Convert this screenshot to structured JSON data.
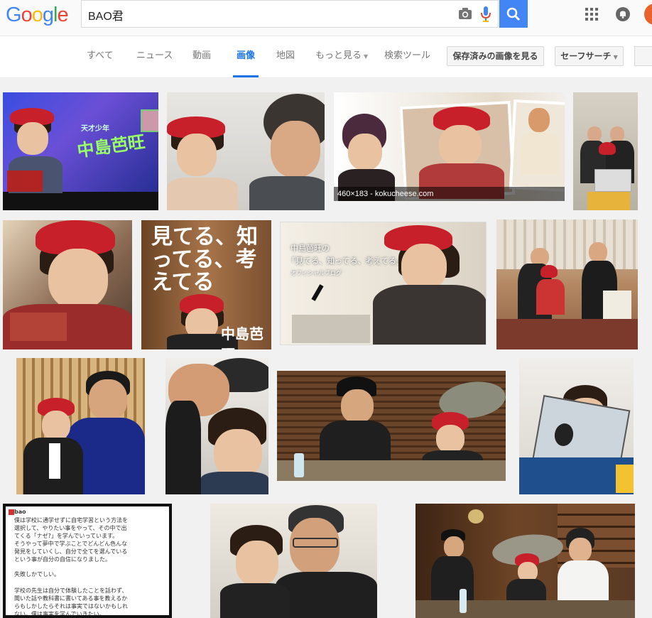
{
  "logo": "Google",
  "search": {
    "query": "BAO君"
  },
  "tabs": [
    {
      "label": "すべて"
    },
    {
      "label": "ニュース"
    },
    {
      "label": "動画"
    },
    {
      "label": "画像"
    },
    {
      "label": "地図"
    },
    {
      "label": "もっと見る"
    },
    {
      "label": "検索ツール"
    }
  ],
  "buttons": {
    "saved_images": "保存済みの画像を見る",
    "safe_search": "セーフサーチ"
  },
  "results": {
    "r1_caption": "460×183 - kokucheese.com",
    "r0_overlay": "中島芭旺",
    "r0_top": "天才少年",
    "r2_title": "見てる、知ってる、考えてる",
    "r2_name": "中島芭旺",
    "r3_line1": "中島芭旺の",
    "r3_line2": "「見てる、知ってる、考えてる」",
    "r3_line3": "オフィシャルブログ",
    "tweet_lines": [
      "僕は学校に通学せずに自宅学習という方法を",
      "選択して、やりたい事をやって、その中で出",
      "てくる「ナゼ?」を学んでいっています。",
      "そうやって夢中で学ぶことでどんどん色んな",
      "発見をしていくし、自分で全てを選んでいる",
      "という事が自分の自信になりました。",
      "失敗しかでしい。",
      "学校の先生は自分で体験したことを話わず、",
      "聞いた話や教科書に書いてある事を教えるか",
      "らもしかしたらそれは事実ではないかもしれ",
      "ない。僕は事実を学んでいきたい。"
    ],
    "tweet_user": "bao"
  }
}
